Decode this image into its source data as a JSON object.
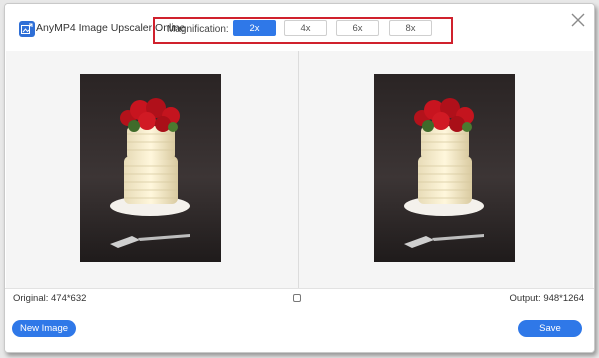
{
  "app": {
    "title": "AnyMP4 Image Upscaler Online",
    "logo_icon": "image-upscale-logo-icon"
  },
  "magnification": {
    "label": "Magnification:",
    "options": [
      "2x",
      "4x",
      "6x",
      "8x"
    ],
    "selected": "2x"
  },
  "status": {
    "original": "Original: 474*632",
    "output": "Output: 948*1264"
  },
  "footer": {
    "new_image_label": "New Image",
    "save_label": "Save"
  },
  "colors": {
    "accent": "#2f78e8",
    "highlight_box": "#d0212d"
  }
}
